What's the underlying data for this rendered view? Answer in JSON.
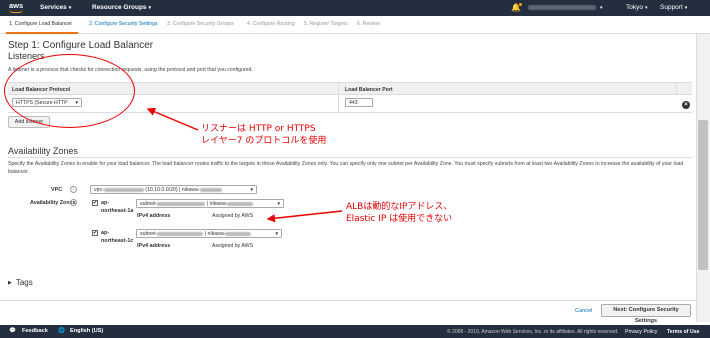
{
  "topbar": {
    "logo": "aws",
    "services": "Services",
    "resource_groups": "Resource Groups",
    "region": "Tokyo",
    "support": "Support"
  },
  "wizard": {
    "steps": [
      "1. Configure Load Balancer",
      "2. Configure Security Settings",
      "3. Configure Security Groups",
      "4. Configure Routing",
      "5. Register Targets",
      "6. Review"
    ]
  },
  "page": {
    "title": "Step 1: Configure Load Balancer",
    "listeners_title": "Listeners",
    "listeners_desc": "A listener is a process that checks for connection requests, using the protocol and port that you configured.",
    "col_protocol": "Load Balancer Protocol",
    "col_port": "Load Balancer Port",
    "protocol_value": "HTTPS (Secure HTTP",
    "port_value": "443",
    "add_listener": "Add listener"
  },
  "az": {
    "title": "Availability Zones",
    "desc": "Specify the Availability Zones to enable for your load balancer. The load balancer routes traffic to the targets in these Availability Zones only. You can specify only one subnet per Availability Zone. You must specify subnets from at least two Availability Zones to increase the availability of your load balancer.",
    "vpc_label": "VPC",
    "vpc_prefix": "vpc-",
    "vpc_mid": "(10.10.0.0/20) | nikawa-",
    "zones_label": "Availability Zones",
    "zone1_name_a": "ap-",
    "zone1_name_b": "northeast-1a",
    "zone2_name_a": "ap-",
    "zone2_name_b": "northeast-1c",
    "subnet_prefix": "subnet-",
    "subnet_mid": "| nikawa-",
    "ipv4_label": "IPv4 address",
    "ipv4_value": "Assigned by AWS"
  },
  "tags": {
    "label": "Tags"
  },
  "actions": {
    "cancel": "Cancel",
    "next": "Next: Configure Security Settings"
  },
  "annotations": {
    "listener_line1": "リスナーは HTTP or HTTPS",
    "listener_line2": "レイヤー7 のプロトコルを使用",
    "alb_line1": "ALBは動的なIPアドレス、",
    "alb_line2": "Elastic IP は使用できない"
  },
  "footer": {
    "feedback": "Feedback",
    "language": "English (US)",
    "copyright": "© 2008 - 2019, Amazon Web Services, Inc. or its affiliates. All rights reserved.",
    "privacy": "Privacy Policy",
    "terms": "Terms of Use"
  },
  "colors": {
    "nav_bg": "#232f3e",
    "accent_orange": "#ec7211",
    "link_blue": "#0073bb",
    "annotation_red": "#e60000"
  },
  "icons": [
    "bell-icon",
    "info-icon",
    "remove-icon",
    "chevron-down-icon",
    "checkbox-icon",
    "feedback-icon",
    "globe-icon"
  ]
}
